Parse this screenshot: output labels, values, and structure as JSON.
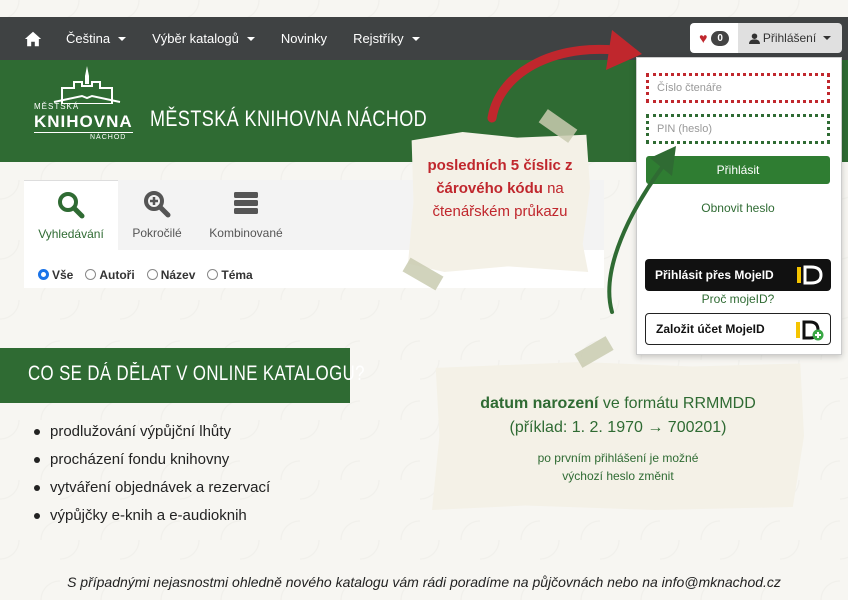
{
  "navbar": {
    "items": [
      "Čeština",
      "Výběr katalogů",
      "Novinky",
      "Rejstříky"
    ],
    "wishlist_count": "0",
    "login_label": "Přihlášení"
  },
  "header": {
    "logo_small": "MĚSTSKÁ",
    "logo_big": "KNIHOVNA",
    "logo_tiny": "NÁCHOD",
    "title": "MĚSTSKÁ KNIHOVNA NÁCHOD"
  },
  "search": {
    "tabs": [
      "Vyhledávání",
      "Pokročilé",
      "Kombinované"
    ],
    "options": [
      "Vše",
      "Autoři",
      "Název",
      "Téma"
    ]
  },
  "login_panel": {
    "reader_placeholder": "Číslo čtenáře",
    "pin_placeholder": "PIN (heslo)",
    "submit": "Přihlásit",
    "reset": "Obnovit heslo",
    "mojeid_login": "Přihlásit přes MojeID",
    "mojeid_why": "Proč mojeID?",
    "mojeid_create": "Založit účet MojeID"
  },
  "note_card": {
    "part1": "posledních 5 číslic z čárového kódu",
    "part2": " na čtenářském průkazu"
  },
  "note_pin": {
    "bold": "datum narození",
    "rest": " ve formátu RRMMDD",
    "example": "(příklad: 1. 2. 1970 → 700201)",
    "sub1": "po prvním přihlášení je možné",
    "sub2": "výchozí heslo změnit"
  },
  "banner": "CO SE DÁ DĚLAT V ONLINE KATALOGU?",
  "features": [
    "prodlužování výpůjční lhůty",
    "procházení fondu knihovny",
    "vytváření objednávek a rezervací",
    "výpůjčky e-knih a e-audioknih"
  ],
  "footer": "S případnými nejasnostmi ohledně nového katalogu vám rádi poradíme na půjčovnách nebo na info@mknachod.cz",
  "colors": {
    "green": "#2f6b33",
    "red": "#c0272d",
    "dark": "#3f4243"
  }
}
